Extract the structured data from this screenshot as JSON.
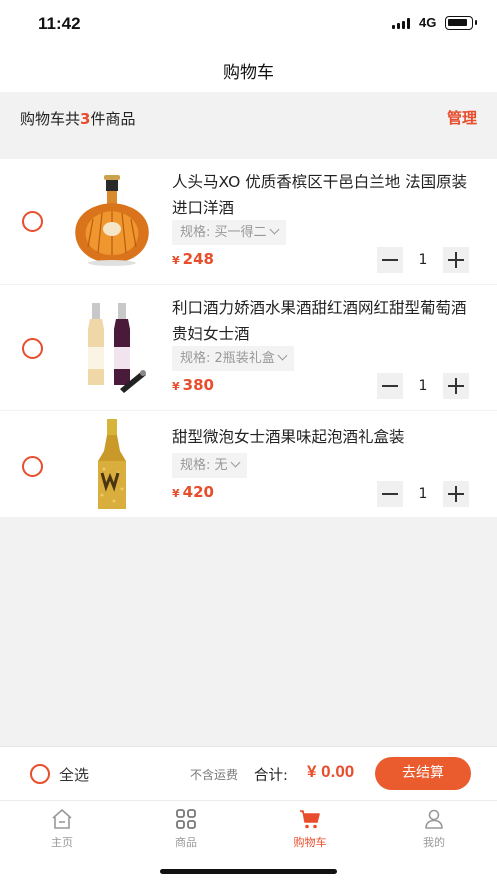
{
  "status_bar": {
    "time": "11:42",
    "network": "4G"
  },
  "nav": {
    "title": "购物车"
  },
  "summary": {
    "prefix": "购物车共",
    "count": "3",
    "suffix": "件商品",
    "manage": "管理"
  },
  "items": [
    {
      "title": "人头马XO 优质香槟区干邑白兰地 法国原装进口洋酒",
      "spec": "规格: 买一得二",
      "price_symbol": "¥",
      "price": "248",
      "quantity": "1",
      "image": "cognac-bottle"
    },
    {
      "title": "利口酒力娇酒水果酒甜红酒网红甜型葡萄酒贵妇女士酒",
      "spec": "规格: 2瓶装礼盒",
      "price_symbol": "¥",
      "price": "380",
      "quantity": "1",
      "image": "liqueur-two-bottles"
    },
    {
      "title": "甜型微泡女士酒果味起泡酒礼盒装",
      "spec": "规格: 无",
      "price_symbol": "¥",
      "price": "420",
      "quantity": "1",
      "image": "sparkling-wine-bottle"
    }
  ],
  "checkout": {
    "select_all": "全选",
    "shipping_note": "不含运费",
    "total_label": "合计:",
    "total_value": "¥ 0.00",
    "pay_button": "去结算"
  },
  "tabbar": {
    "items": [
      {
        "label": "主页",
        "icon": "home-icon"
      },
      {
        "label": "商品",
        "icon": "grid-icon"
      },
      {
        "label": "购物车",
        "icon": "cart-icon"
      },
      {
        "label": "我的",
        "icon": "user-icon"
      }
    ],
    "active": "购物车"
  },
  "colors": {
    "accent": "#e84d2c",
    "background": "#f2f2f2"
  }
}
